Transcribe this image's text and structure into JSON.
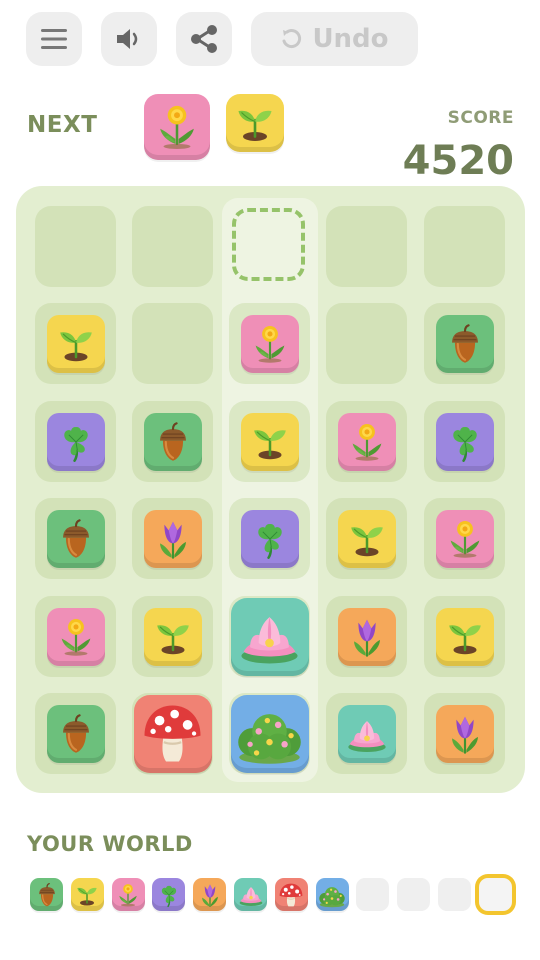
{
  "toolbar": {
    "menu_icon": "menu-icon",
    "sound_icon": "speaker-icon",
    "share_icon": "share-icon",
    "undo_icon": "undo-icon",
    "undo_label": "Undo"
  },
  "next": {
    "label": "NEXT",
    "items": [
      "dandelion",
      "sprout"
    ]
  },
  "score": {
    "label": "SCORE",
    "value": "4520"
  },
  "board": {
    "columns": 5,
    "rows": 6,
    "highlighted_column": 3,
    "drop_target": {
      "row": 1,
      "col": 3
    },
    "grid": [
      [
        null,
        null,
        null,
        null,
        null
      ],
      [
        "sprout",
        null,
        "dandelion",
        null,
        "acorn"
      ],
      [
        "clover",
        "acorn",
        "sprout",
        "dandelion",
        "clover"
      ],
      [
        "acorn",
        "tulip",
        "clover",
        "sprout",
        "dandelion"
      ],
      [
        "dandelion",
        "sprout",
        "lotus",
        "tulip",
        "sprout"
      ],
      [
        "acorn",
        "mushroom",
        "bush",
        "lotus",
        "tulip"
      ]
    ]
  },
  "world": {
    "label": "YOUR WORLD",
    "unlocked": [
      "acorn",
      "sprout",
      "dandelion",
      "clover",
      "tulip",
      "lotus",
      "mushroom",
      "bush"
    ],
    "locked_slots": 4,
    "current_slot_index": 11
  },
  "tile_colors": {
    "sprout": "#f5d64f",
    "dandelion": "#ef8fb7",
    "acorn": "#6cc07c",
    "clover": "#9b86df",
    "tulip": "#f5a85a",
    "lotus": "#6fcbb5",
    "mushroom": "#f08274",
    "bush": "#73aee6"
  }
}
